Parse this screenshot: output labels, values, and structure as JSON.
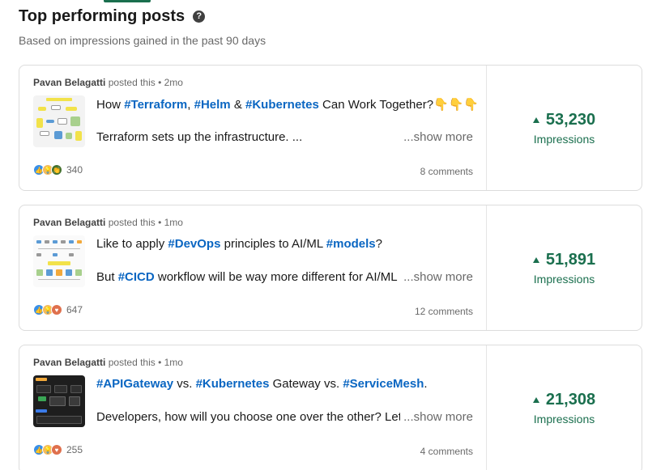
{
  "header": {
    "title": "Top performing posts",
    "help_icon": "?",
    "subtitle": "Based on impressions gained in the past 90 days"
  },
  "colors": {
    "accent_green": "#1a6f4e",
    "hashtag_blue": "#0a66c2"
  },
  "posts": [
    {
      "author": "Pavan Belagatti",
      "posted_text": "posted this • 2mo",
      "line1": [
        {
          "t": "How ",
          "tag": false
        },
        {
          "t": "#Terraform",
          "tag": true
        },
        {
          "t": ", ",
          "tag": false
        },
        {
          "t": "#Helm",
          "tag": true
        },
        {
          "t": " & ",
          "tag": false
        },
        {
          "t": "#Kubernetes",
          "tag": true
        },
        {
          "t": " Can Work Together?👇👇👇",
          "tag": false
        }
      ],
      "line2": [
        {
          "t": "Terraform sets up the infrastructure. ...",
          "tag": false
        }
      ],
      "show_more": "...show more",
      "reactions": [
        "like",
        "insight",
        "celebrate"
      ],
      "reaction_count": "340",
      "comments": "8 comments",
      "impressions": "53,230",
      "impressions_label": "Impressions",
      "thumbnail_icon": "diagram-thumbnail"
    },
    {
      "author": "Pavan Belagatti",
      "posted_text": "posted this • 1mo",
      "line1": [
        {
          "t": "Like to apply ",
          "tag": false
        },
        {
          "t": "#DevOps",
          "tag": true
        },
        {
          "t": " principles to AI/ML ",
          "tag": false
        },
        {
          "t": "#models",
          "tag": true
        },
        {
          "t": "?",
          "tag": false
        }
      ],
      "line2": [
        {
          "t": "But ",
          "tag": false
        },
        {
          "t": "#CICD",
          "tag": true
        },
        {
          "t": " workflow will be way more different for AI/ML a",
          "tag": false
        }
      ],
      "show_more": "...show more",
      "reactions": [
        "like",
        "insight",
        "love"
      ],
      "reaction_count": "647",
      "comments": "12 comments",
      "impressions": "51,891",
      "impressions_label": "Impressions",
      "thumbnail_icon": "workflow-thumbnail"
    },
    {
      "author": "Pavan Belagatti",
      "posted_text": "posted this • 1mo",
      "line1": [
        {
          "t": "#APIGateway",
          "tag": true
        },
        {
          "t": " vs. ",
          "tag": false
        },
        {
          "t": "#Kubernetes",
          "tag": true
        },
        {
          "t": " Gateway vs. ",
          "tag": false
        },
        {
          "t": "#ServiceMesh",
          "tag": true
        },
        {
          "t": ".",
          "tag": false
        }
      ],
      "line2": [
        {
          "t": "Developers, how will you choose one over the other? Let'",
          "tag": false
        }
      ],
      "show_more": "...show more",
      "reactions": [
        "like",
        "insight",
        "love"
      ],
      "reaction_count": "255",
      "comments": "4 comments",
      "impressions": "21,308",
      "impressions_label": "Impressions",
      "thumbnail_icon": "architecture-thumbnail"
    }
  ]
}
